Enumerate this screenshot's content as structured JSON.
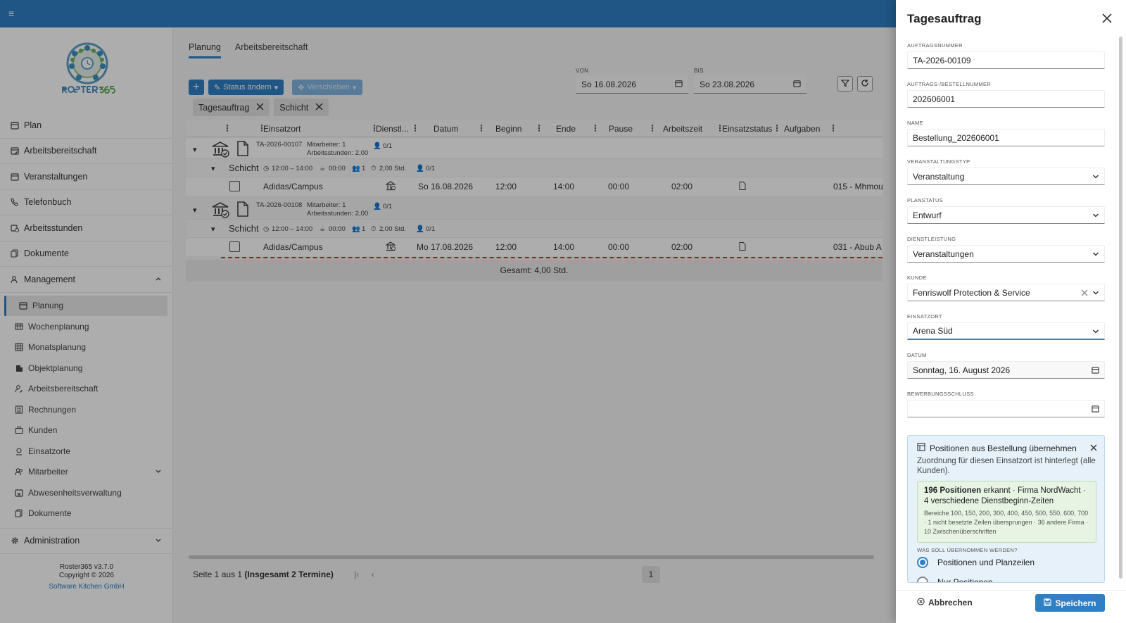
{
  "app": {
    "version_line": "Roster365 v3.7.0",
    "copyright_line": "Copyright © 2026",
    "company_link": "Software Kitchen GmbH",
    "accent_color": "#2f7fc4"
  },
  "sidebar": {
    "items": [
      {
        "label": "Plan",
        "icon": "calendar-icon"
      },
      {
        "label": "Arbeitsbereitschaft",
        "icon": "calendar-edit-icon"
      },
      {
        "label": "Veranstaltungen",
        "icon": "calendar-icon"
      },
      {
        "label": "Telefonbuch",
        "icon": "phone-book-icon"
      },
      {
        "label": "Arbeitsstunden",
        "icon": "calendar-clock-icon"
      },
      {
        "label": "Dokumente",
        "icon": "documents-icon"
      },
      {
        "label": "Management",
        "icon": "users-icon"
      }
    ],
    "management_items": [
      {
        "label": "Planung",
        "icon": "calendar-edit-icon"
      },
      {
        "label": "Wochenplanung",
        "icon": "table-icon"
      },
      {
        "label": "Monatsplanung",
        "icon": "grid-icon"
      },
      {
        "label": "Objektplanung",
        "icon": "building-icon"
      },
      {
        "label": "Arbeitsbereitschaft",
        "icon": "user-edit-icon"
      },
      {
        "label": "Rechnungen",
        "icon": "list-icon"
      },
      {
        "label": "Kunden",
        "icon": "briefcase-icon"
      },
      {
        "label": "Einsatzorte",
        "icon": "location-icon"
      },
      {
        "label": "Mitarbeiter",
        "icon": "users-icon"
      },
      {
        "label": "Abwesenheitsverwaltung",
        "icon": "calendar-x-icon"
      },
      {
        "label": "Dokumente",
        "icon": "documents-icon"
      }
    ],
    "admin_label": "Administration"
  },
  "main": {
    "tabs": [
      {
        "label": "Planung"
      },
      {
        "label": "Arbeitsbereitschaft"
      }
    ],
    "toolbar": {
      "status_label": "Status ändern",
      "move_label": "Verschieben"
    },
    "von": {
      "label": "VON",
      "value": "So 16.08.2026"
    },
    "bis": {
      "label": "BIS",
      "value": "So 23.08.2026"
    },
    "chips": [
      {
        "label": "Tagesauftrag"
      },
      {
        "label": "Schicht"
      }
    ],
    "columns": {
      "einsatzort": "Einsatzort",
      "dienst": "Dienstl...",
      "datum": "Datum",
      "beginn": "Beginn",
      "ende": "Ende",
      "pause": "Pause",
      "arbeitszeit": "Arbeitszeit",
      "einsatzstatus": "Einsatzstatus",
      "aufgaben": "Aufgaben"
    },
    "groups": [
      {
        "order_no": "TA-2026-00107",
        "staff": "Mitarbeiter: 1",
        "hours": "Arbeitsstunden: 2,00",
        "fill": "0/1",
        "shift_label": "Schicht",
        "shift_time": "12:00 – 14:00",
        "shift_pause": "00:00",
        "shift_staff": "1",
        "shift_hours": "2,00 Std.",
        "shift_fill": "0/1",
        "row": {
          "location": "Adidas/Campus",
          "date": "So 16.08.2026",
          "begin": "12:00",
          "end": "14:00",
          "pause": "00:00",
          "work": "02:00",
          "task": "015 - Mhmou"
        }
      },
      {
        "order_no": "TA-2026-00108",
        "staff": "Mitarbeiter: 1",
        "hours": "Arbeitsstunden: 2,00",
        "fill": "0/1",
        "shift_label": "Schicht",
        "shift_time": "12:00 – 14:00",
        "shift_pause": "00:00",
        "shift_staff": "1",
        "shift_hours": "2,00 Std.",
        "shift_fill": "0/1",
        "row": {
          "location": "Adidas/Campus",
          "date": "Mo 17.08.2026",
          "begin": "12:00",
          "end": "14:00",
          "pause": "00:00",
          "work": "02:00",
          "task": "031 - Abub A"
        }
      }
    ],
    "total": "Gesamt: 4,00 Std.",
    "pager_prefix": "Seite 1 aus 1 ",
    "pager_bold": "(Insgesamt 2 Termine)",
    "page_number": "1"
  },
  "drawer": {
    "title": "Tagesauftrag",
    "fields": {
      "auftragsnummer": {
        "label": "Auftragsnummer",
        "value": "TA-2026-00109"
      },
      "bestellnummer": {
        "label": "Auftrags-/Bestellnummer",
        "value": "202606001"
      },
      "name": {
        "label": "Name",
        "value": "Bestellung_202606001"
      },
      "veranstaltungstyp": {
        "label": "Veranstaltungstyp",
        "value": "Veranstaltung"
      },
      "planstatus": {
        "label": "Planstatus",
        "value": "Entwurf"
      },
      "dienstleistung": {
        "label": "Dienstleistung",
        "value": "Veranstaltungen"
      },
      "kunde": {
        "label": "Kunde",
        "value": "Fenriswolf Protection & Service"
      },
      "einsatzort": {
        "label": "Einsatzort",
        "value": "Arena Süd"
      },
      "datum": {
        "label": "Datum",
        "value": "Sonntag, 16. August 2026"
      },
      "bewerbungsschluss": {
        "label": "Bewerbungsschluss",
        "value": ""
      }
    },
    "info": {
      "title": "Positionen aus Bestellung übernehmen",
      "description": "Zuordnung für diesen Einsatzort ist hinterlegt (alle Kunden).",
      "count_bold": "196 Positionen",
      "count_rest": " erkannt · Firma NordWacht · 4 verschiedene Dienstbeginn-Zeiten",
      "details": "Bereiche 100, 150, 200, 300, 400, 450, 500, 550, 600, 700 · 1 nicht besetzte Zeilen übersprungen · 36 andere Firma · 10 Zwischenüberschriften",
      "question": "WAS SOLL ÜBERNOMMEN WERDEN?",
      "options": [
        {
          "label": "Positionen und Planzeilen",
          "selected": true
        },
        {
          "label": "Nur Positionen",
          "selected": false
        }
      ]
    },
    "cancel_label": "Abbrechen",
    "save_label": "Speichern"
  }
}
